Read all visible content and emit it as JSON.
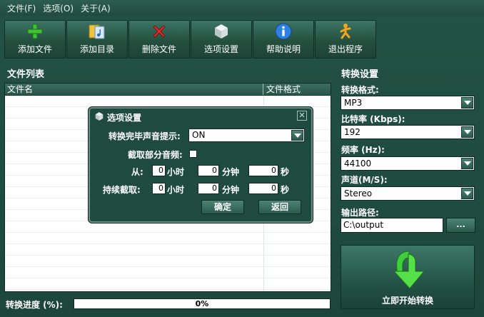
{
  "menu": {
    "file": "文件(F)",
    "options": "选项(O)",
    "about": "关于(A)"
  },
  "toolbar": {
    "add_file": "添加文件",
    "add_dir": "添加目录",
    "delete_file": "删除文件",
    "options": "选项设置",
    "help": "帮助说明",
    "exit": "退出程序"
  },
  "file_list": {
    "title": "文件列表",
    "col_name": "文件名",
    "col_format": "文件格式"
  },
  "progress": {
    "label": "转换进度 (%):",
    "value_text": "0%",
    "fraction": 0
  },
  "settings": {
    "title": "转换设置",
    "format_label": "转换格式:",
    "format_value": "MP3",
    "bitrate_label": "比特率 (Kbps):",
    "bitrate_value": "192",
    "freq_label": "频率 (Hz):",
    "freq_value": "44100",
    "channel_label": "声道(M/S):",
    "channel_value": "Stereo",
    "output_label": "输出路径:",
    "output_value": "C:\\output",
    "browse_label": "...",
    "start_label": "立即开始转换"
  },
  "dialog": {
    "title": "选项设置",
    "sound_label": "转换完毕声音提示:",
    "sound_value": "ON",
    "partial_label": "截取部分音频:",
    "from_label": "从:",
    "duration_label": "持续截取:",
    "hour_unit": "小时",
    "min_unit": "分钟",
    "sec_unit": "秒",
    "from_hour": "0",
    "from_min": "0",
    "from_sec": "0",
    "dur_hour": "0",
    "dur_min": "0",
    "dur_sec": "0",
    "ok_label": "确定",
    "back_label": "返回",
    "close_glyph": "✕"
  },
  "colors": {
    "window_bg": "#1f4a3f",
    "accent_green": "#3aa36a"
  },
  "icons": [
    "plus-icon",
    "folder-music-icon",
    "delete-x-icon",
    "cube-icon",
    "info-icon",
    "exit-runner-icon",
    "start-arrow-icon"
  ]
}
